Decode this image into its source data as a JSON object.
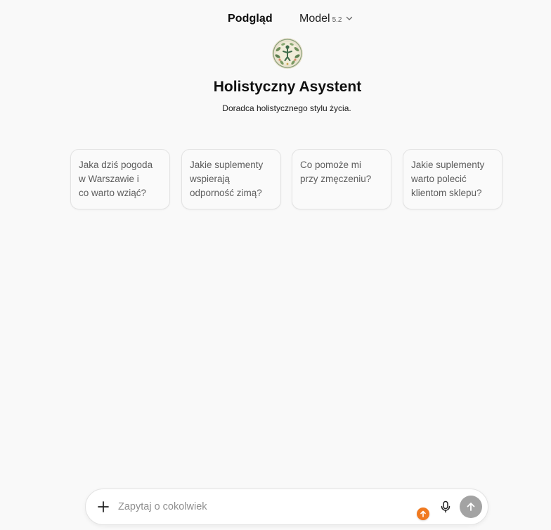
{
  "header": {
    "preview_tab": "Podgląd",
    "model_label": "Model",
    "model_version": "5.2",
    "chevron_icon": "chevron-down-icon"
  },
  "assistant": {
    "avatar_icon": "holistic-figure-emblem",
    "name": "Holistyczny Asystent",
    "description": "Doradca holistycznego stylu życia."
  },
  "suggestions": [
    {
      "text": "Jaka dziś pogoda\nw Warszawie i\nco warto wziąć?"
    },
    {
      "text": "Jakie suplementy\nwspierają\nodporność zimą?"
    },
    {
      "text": "Co pomoże mi\nprzy zmęczeniu?"
    },
    {
      "text": "Jakie suplementy\nwarto polecić\nklientom sklepu?"
    }
  ],
  "composer": {
    "placeholder": "Zapytaj o cokolwiek",
    "value": "",
    "plus_icon": "plus-icon",
    "mic_icon": "microphone-icon",
    "send_icon": "arrow-up-icon"
  },
  "badge": {
    "icon": "arrow-up-icon",
    "color": "#f0791f"
  },
  "colors": {
    "background": "#f9f9f9",
    "card_border": "#e3e3e3",
    "send_button": "#a3a3a3",
    "accent_orange": "#f0791f"
  }
}
